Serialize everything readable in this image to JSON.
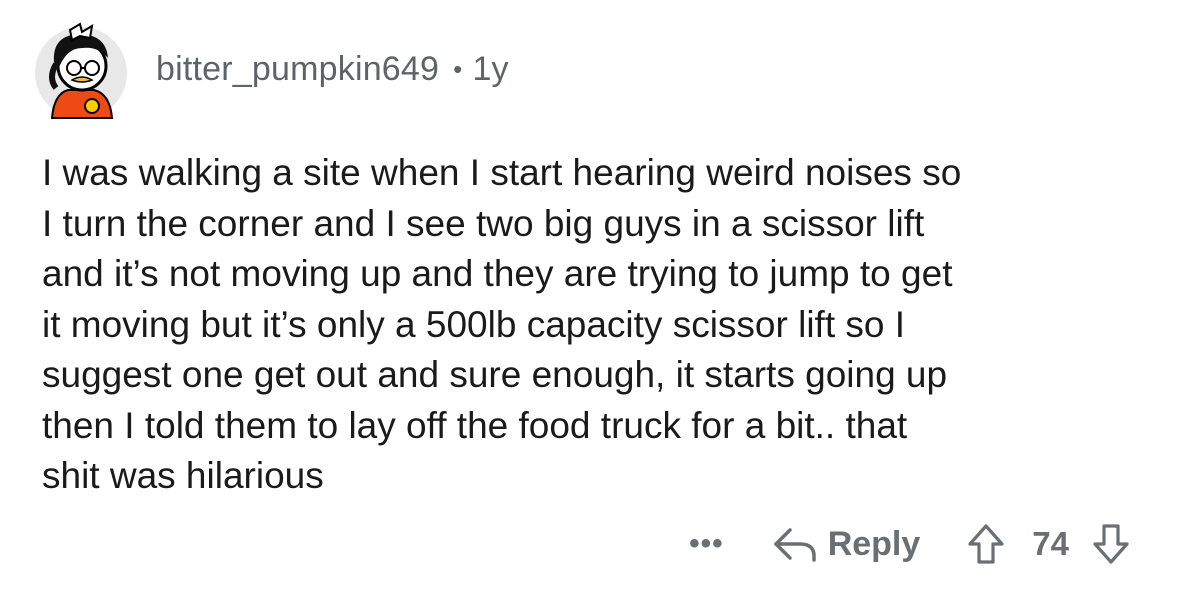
{
  "comment": {
    "author": "bitter_pumpkin649",
    "separator": "•",
    "age": "1y",
    "body_lines": [
      "I was walking a site when I start hearing weird noises so",
      "I turn the corner and I see two big guys in a scissor lift",
      "and it’s not moving up and they are trying to jump to get",
      "it moving but it’s only a 500lb capacity scissor lift so I",
      "suggest one get out and sure enough, it starts going up",
      "then I told them to lay off the food truck for a bit.. that",
      "shit was hilarious"
    ],
    "actions": {
      "more_label": "•••",
      "reply_label": "Reply",
      "vote_count": "74"
    }
  },
  "colors": {
    "text": "#1a1a1b",
    "meta": "#5f6368",
    "action": "#6b6e72",
    "avatar_bg": "#e8e8e8",
    "avatar_shirt": "#f04a14",
    "avatar_accent": "#ffcc00"
  }
}
